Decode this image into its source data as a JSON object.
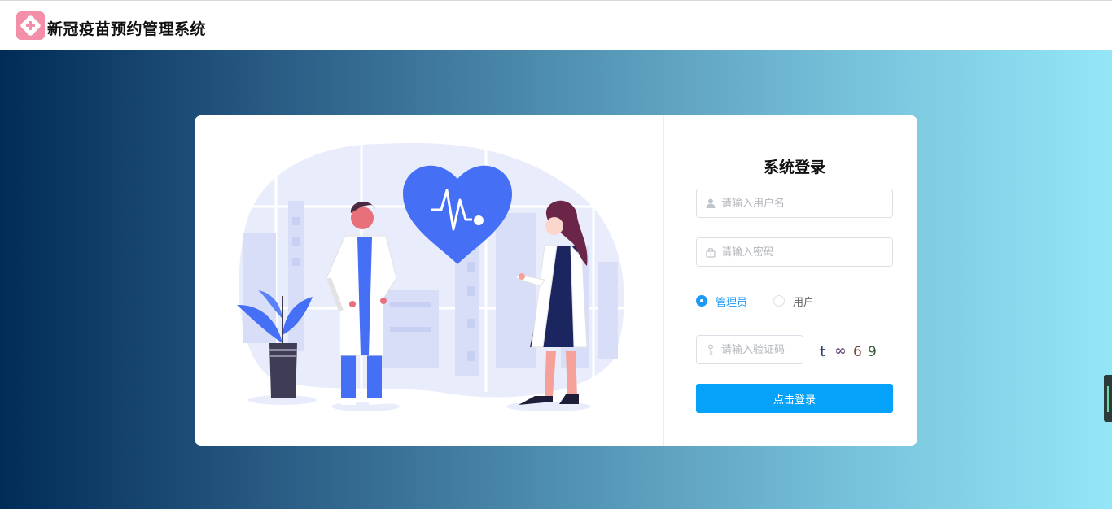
{
  "header": {
    "app_title": "新冠疫苗预约管理系统",
    "logo_icon": "medical-cross-icon",
    "logo_color": "#f38fa8"
  },
  "background": {
    "gradient_from": "#002c57",
    "gradient_to": "#94e6f7"
  },
  "login": {
    "title": "系统登录",
    "username": {
      "value": "",
      "placeholder": "请输入用户名",
      "icon": "user-icon"
    },
    "password": {
      "value": "",
      "placeholder": "请输入密码",
      "icon": "lock-icon"
    },
    "roles": [
      {
        "label": "管理员",
        "checked": true
      },
      {
        "label": "用户",
        "checked": false
      }
    ],
    "captcha_input": {
      "value": "",
      "placeholder": "请输入验证码",
      "icon": "key-icon"
    },
    "captcha_chars": [
      "t",
      "∞",
      "6",
      "9"
    ],
    "submit_label": "点击登录",
    "accent": "#06a1f9"
  },
  "illustration": {
    "description_icon": "doctors-heart-illustration",
    "heart_color": "#4570f5"
  }
}
